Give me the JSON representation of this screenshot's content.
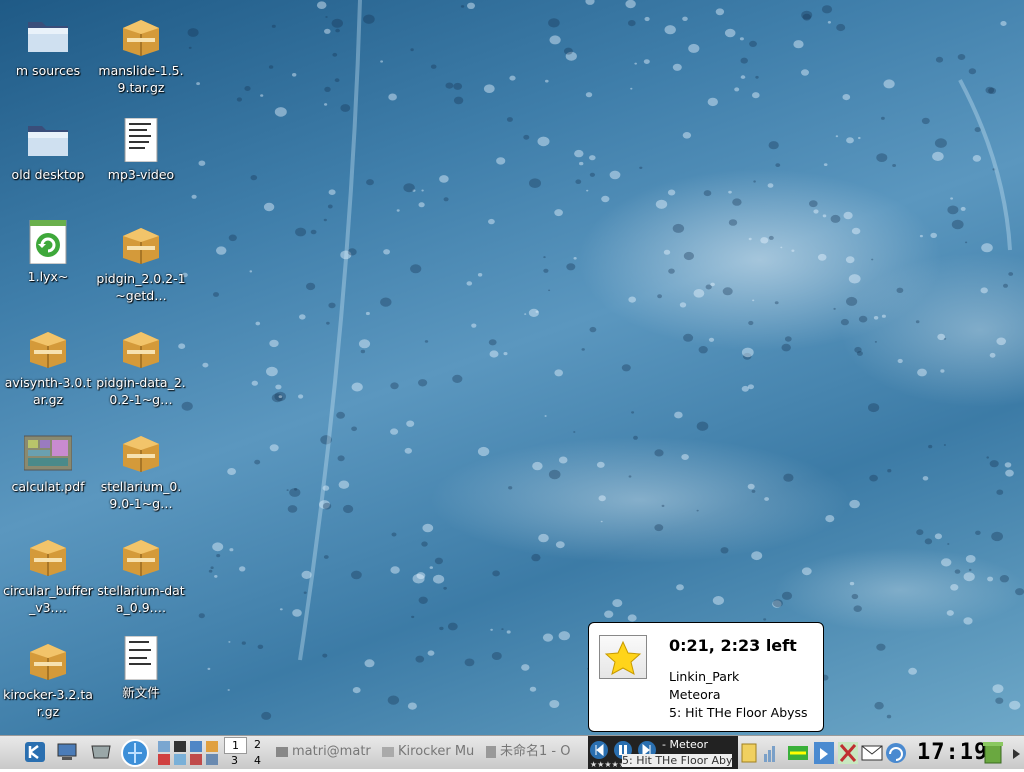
{
  "desktop_icons": [
    {
      "label": "m sources",
      "type": "folder"
    },
    {
      "label": "manslide-1.5.9.tar.gz",
      "type": "package"
    },
    {
      "label": "old desktop",
      "type": "folder"
    },
    {
      "label": "mp3-video",
      "type": "script"
    },
    {
      "label": "1.lyx~",
      "type": "lyx"
    },
    {
      "label": "pidgin_2.0.2-1~getd…",
      "type": "package"
    },
    {
      "label": "avisynth-3.0.tar.gz",
      "type": "package"
    },
    {
      "label": "pidgin-data_2.0.2-1~g…",
      "type": "package"
    },
    {
      "label": "calculat.pdf",
      "type": "pdf"
    },
    {
      "label": "stellarium_0.9.0-1~g…",
      "type": "package"
    },
    {
      "label": "circular_buffer_v3.…",
      "type": "package"
    },
    {
      "label": "stellarium-data_0.9.…",
      "type": "package"
    },
    {
      "label": "kirocker-3.2.tar.gz",
      "type": "package"
    },
    {
      "label": "新文件",
      "type": "text"
    }
  ],
  "popup": {
    "time": "0:21, 2:23 left",
    "artist": "Linkin_Park",
    "album": "Meteora",
    "track": "5: Hit THe Floor Abyss"
  },
  "taskbar": {
    "pager": [
      "1",
      "2",
      "3",
      "4"
    ],
    "tasks": [
      "matri@matr",
      "Kirocker Mu",
      "未命名1 - O"
    ],
    "nowplaying_line1": "- Meteor",
    "nowplaying_line2": "5: Hit THe Floor Aby",
    "clock": "17:19"
  },
  "colors": {
    "accent": "#2a6fb0",
    "popup_bg": "#ffffff"
  }
}
